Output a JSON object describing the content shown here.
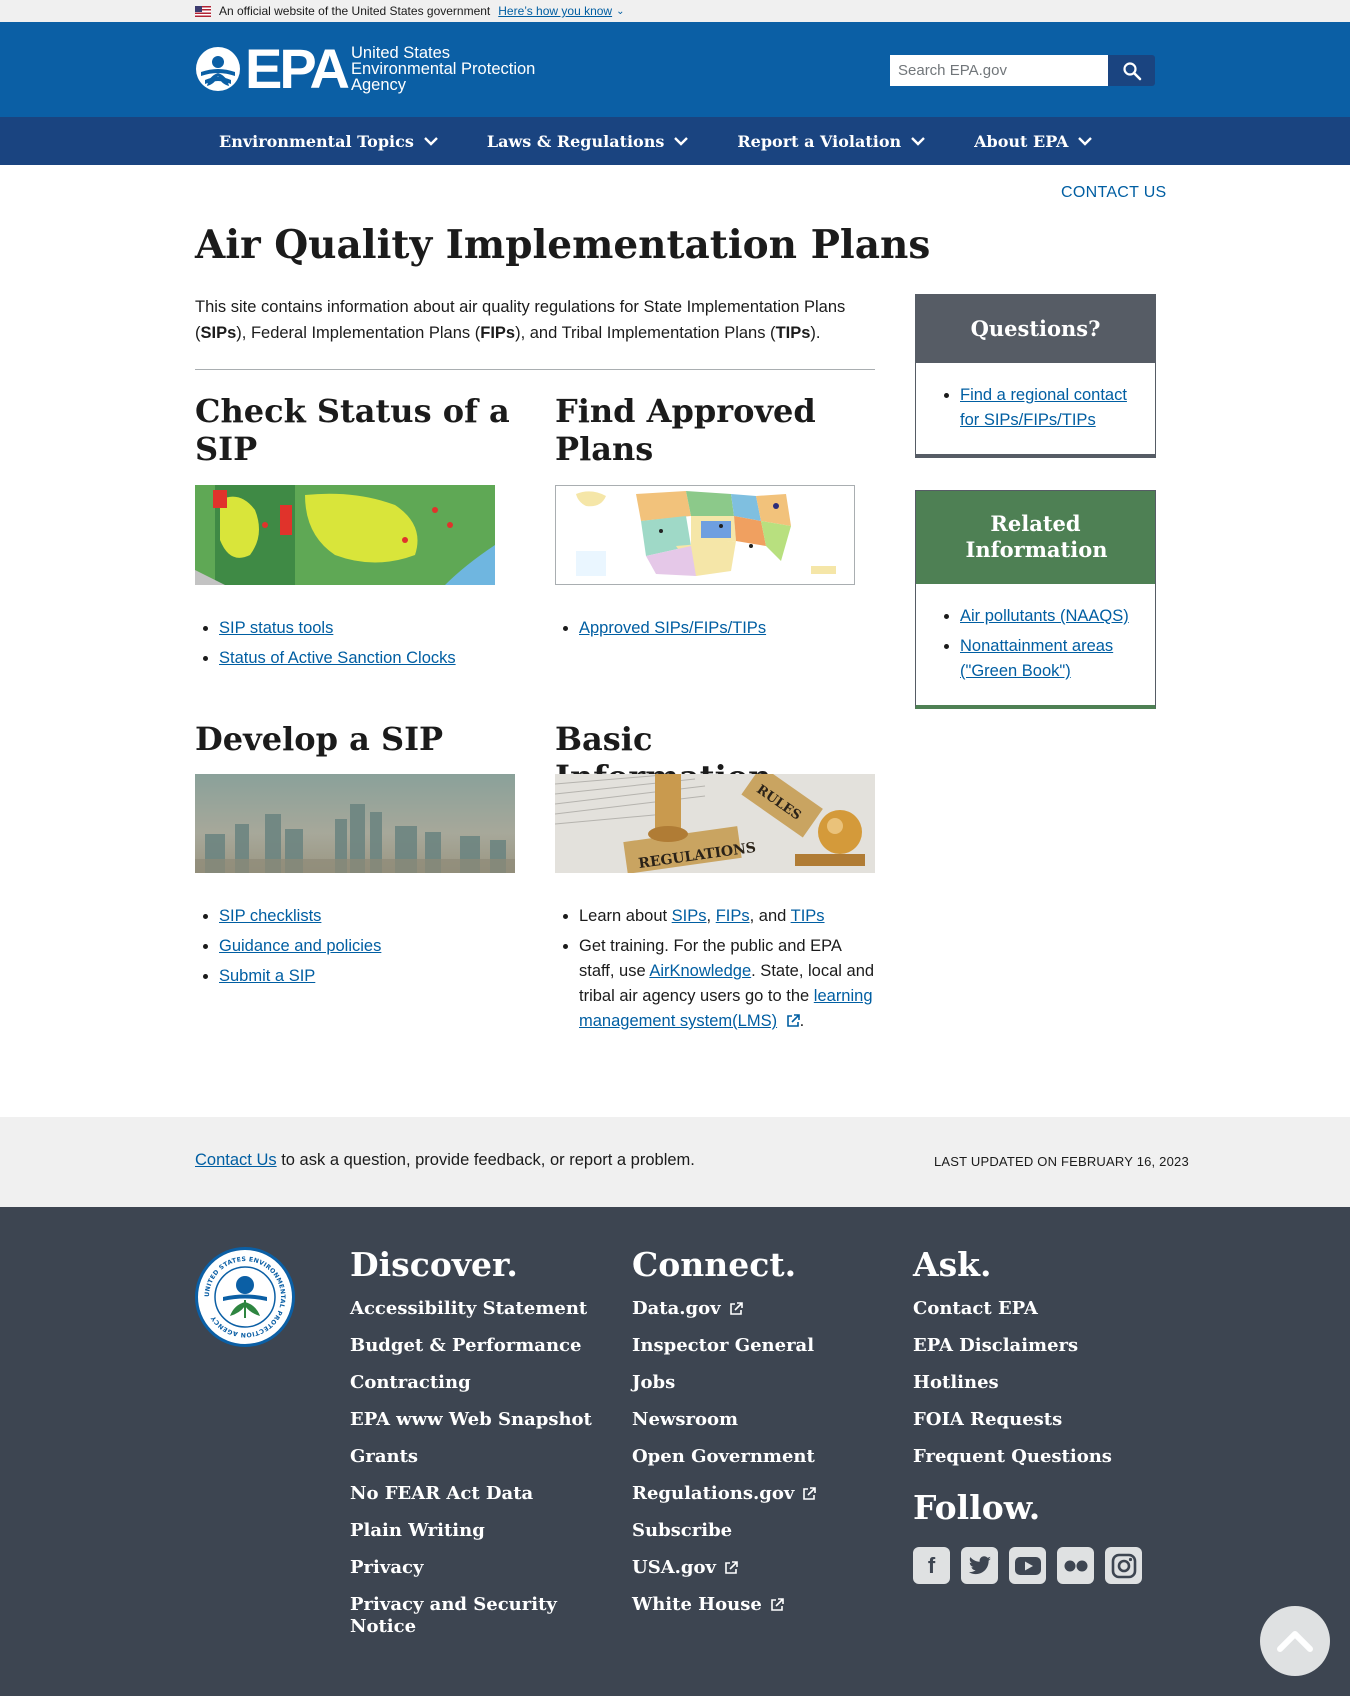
{
  "banner": {
    "text": "An official website of the United States government",
    "link": "Here’s how you know"
  },
  "header": {
    "logo_acronym": "EPA",
    "logo_line1": "United States",
    "logo_line2": "Environmental Protection",
    "logo_line3": "Agency",
    "search_placeholder": "Search EPA.gov"
  },
  "nav": {
    "items": [
      {
        "label": "Environmental Topics"
      },
      {
        "label": "Laws & Regulations"
      },
      {
        "label": "Report a Violation"
      },
      {
        "label": "About EPA"
      }
    ]
  },
  "main": {
    "contact_us": "CONTACT US",
    "title": "Air Quality Implementation Plans",
    "intro": {
      "t1": "This site contains information about air quality regulations for State Implementation Plans (",
      "b1": "SIPs",
      "t2": "), Federal Implementation Plans (",
      "b2": "FIPs",
      "t3": "), and Tribal Implementation Plans (",
      "b3": "TIPs",
      "t4": ")."
    },
    "sections": {
      "check_status": {
        "heading": "Check Status of a SIP",
        "links": [
          "SIP status tools",
          "Status of  Active Sanction Clocks"
        ]
      },
      "find_approved": {
        "heading": "Find Approved Plans",
        "links": [
          "Approved SIPs/FIPs/TIPs"
        ]
      },
      "develop": {
        "heading": "Develop a SIP",
        "links": [
          "SIP checklists",
          "Guidance and policies",
          "Submit a SIP"
        ]
      },
      "basic": {
        "heading": "Basic Information",
        "item1": {
          "t1": "Learn about ",
          "l1": "SIPs",
          "t2": ", ",
          "l2": "FIPs",
          "t3": ", and ",
          "l3": "TIPs"
        },
        "item2": {
          "t1": "Get training. For the public and EPA staff, use ",
          "l1": "AirKnowledge",
          "t2": ". State, local and tribal air agency users go to the ",
          "l2": "learning management system(LMS)",
          "t3": "."
        },
        "image_text_1": "REGULATIONS",
        "image_text_2": "RULES"
      }
    }
  },
  "sidebar": {
    "questions": {
      "heading": "Questions?",
      "header_color": "#565c65",
      "links": [
        "Find a regional contact for SIPs/FIPs/TIPs"
      ]
    },
    "related": {
      "heading": "Related Information",
      "header_color": "#538200",
      "links": [
        "Air pollutants (NAAQS)",
        "Nonattainment areas (\"Green Book\")"
      ]
    }
  },
  "updated_bar": {
    "contact_link": "Contact Us",
    "contact_text": " to ask a question, provide feedback, or report a problem.",
    "last_updated": "LAST UPDATED ON FEBRUARY 16, 2023"
  },
  "footer": {
    "discover": {
      "heading": "Discover.",
      "items": [
        "Accessibility Statement",
        "Budget & Performance",
        "Contracting",
        "EPA www Web Snapshot",
        "Grants",
        "No FEAR Act Data",
        "Plain Writing",
        "Privacy",
        "Privacy and Security Notice"
      ]
    },
    "connect": {
      "heading": "Connect.",
      "items": [
        "Data.gov",
        "Inspector General",
        "Jobs",
        "Newsroom",
        "Open Government",
        "Regulations.gov",
        "Subscribe",
        "USA.gov",
        "White House"
      ]
    },
    "ask": {
      "heading": "Ask.",
      "items": [
        "Contact EPA",
        "EPA Disclaimers",
        "Hotlines",
        "FOIA Requests",
        "Frequent Questions"
      ]
    },
    "follow": {
      "heading": "Follow.",
      "icons": [
        "facebook-icon",
        "twitter-icon",
        "youtube-icon",
        "flickr-icon",
        "instagram-icon"
      ]
    },
    "seal_text": "UNITED STATES ENVIRONMENTAL PROTECTION AGENCY"
  },
  "colors": {
    "header_blue": "#0b5fa5",
    "nav_blue": "#1a4480",
    "link": "#005ea2",
    "footer_bg": "#3d4551"
  }
}
